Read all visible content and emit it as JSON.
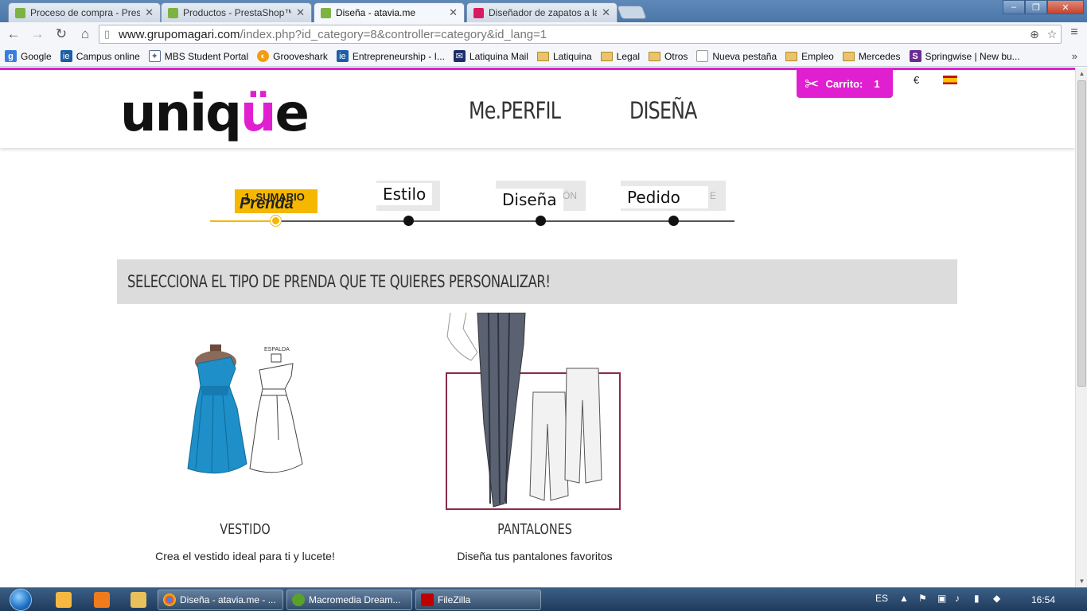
{
  "tabs": [
    {
      "label": "Proceso de compra - Presta",
      "icon": "prestashop-icon"
    },
    {
      "label": "Productos - PrestaShop™",
      "icon": "prestashop-icon"
    },
    {
      "label": "Diseña - atavia.me",
      "icon": "prestashop-icon"
    },
    {
      "label": "Diseñador de zapatos a la",
      "icon": "designer-icon"
    }
  ],
  "address": {
    "host": "www.grupomagari.com",
    "path": "/index.php?id_category=8&controller=category&id_lang=1"
  },
  "bookmarks": [
    {
      "label": "Google",
      "icon": "google-icon"
    },
    {
      "label": "Campus online",
      "icon": "ie-icon"
    },
    {
      "label": "MBS Student Portal",
      "icon": "mbs-icon"
    },
    {
      "label": "Grooveshark",
      "icon": "grooveshark-icon"
    },
    {
      "label": "Entrepreneurship - I...",
      "icon": "ie-icon"
    },
    {
      "label": "Latiquina Mail",
      "icon": "mail-icon"
    },
    {
      "label": "Latiquina",
      "icon": "folder-icon"
    },
    {
      "label": "Legal",
      "icon": "folder-icon"
    },
    {
      "label": "Otros",
      "icon": "folder-icon"
    },
    {
      "label": "Nueva pestaña",
      "icon": "page-icon"
    },
    {
      "label": "Empleo",
      "icon": "folder-icon"
    },
    {
      "label": "Mercedes",
      "icon": "folder-icon"
    },
    {
      "label": "Springwise | New bu...",
      "icon": "springwise-icon"
    }
  ],
  "header": {
    "logo": "uniqüe",
    "nav": [
      "Me.PERFIL",
      "DISEÑA"
    ],
    "cart_label": "Carrito:",
    "cart_count": "1",
    "currency": "€"
  },
  "steps": {
    "first_top": "1. SUMARIO",
    "first": "Prenda",
    "items": [
      "Estilo",
      "Diseña",
      "Pedido"
    ],
    "ghost": [
      "",
      "ÓN",
      "E"
    ]
  },
  "section": {
    "title": "SELECCIONA EL TIPO DE PRENDA QUE TE QUIERES PERSONALIZAR!"
  },
  "products": [
    {
      "name": "VESTIDO",
      "desc": "Crea el vestido ideal para ti y lucete!",
      "image_text": "ESPALDA"
    },
    {
      "name": "PANTALONES",
      "desc": "Diseña tus pantalones favoritos"
    }
  ],
  "taskbar": {
    "tasks": [
      "Diseña - atavia.me - ...",
      "Macromedia Dream...",
      "FileZilla"
    ],
    "lang": "ES",
    "time": "16:54"
  },
  "colors": {
    "brand": "#e020d0",
    "step_active": "#f5b700"
  }
}
